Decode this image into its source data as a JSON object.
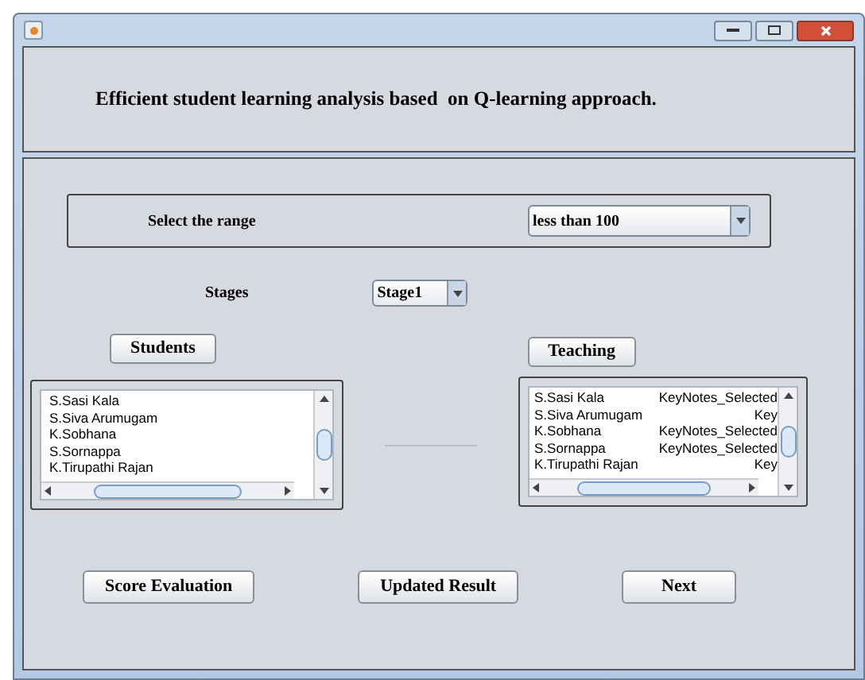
{
  "header": {
    "title": "Efficient student learning analysis based  on Q-learning approach."
  },
  "range": {
    "label": "Select the range",
    "value": "less than 100"
  },
  "stages": {
    "label": "Stages",
    "value": "Stage1"
  },
  "students": {
    "button": "Students",
    "items": [
      "S.Sasi Kala",
      "S.Siva Arumugam",
      "K.Sobhana",
      "S.Sornappa",
      "K.Tirupathi Rajan"
    ]
  },
  "teaching": {
    "button": "Teaching",
    "rows": [
      {
        "name": "S.Sasi Kala",
        "note": "KeyNotes_Selected"
      },
      {
        "name": "S.Siva Arumugam",
        "note": "Key"
      },
      {
        "name": "K.Sobhana",
        "note": "KeyNotes_Selected"
      },
      {
        "name": "S.Sornappa",
        "note": "KeyNotes_Selected"
      },
      {
        "name": "K.Tirupathi Rajan",
        "note": "Key"
      }
    ]
  },
  "buttons": [
    "Score Evaluation",
    "Updated Result",
    "Next"
  ]
}
